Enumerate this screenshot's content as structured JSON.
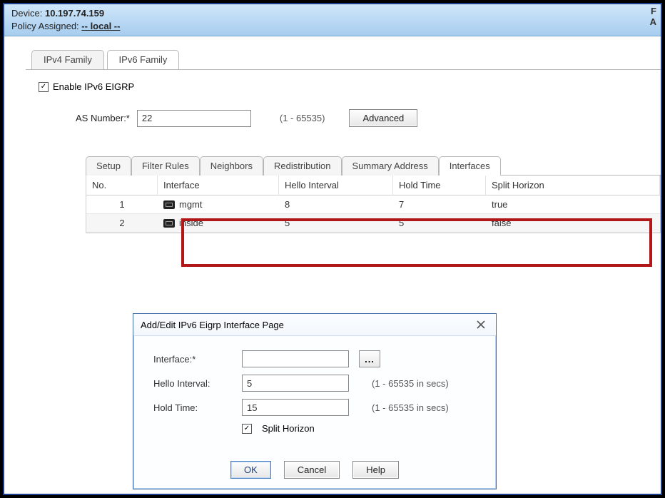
{
  "header": {
    "device_label": "Device:",
    "device_value": "10.197.74.159",
    "policy_label": "Policy Assigned:",
    "policy_value": "-- local --",
    "right1": "F",
    "right2": "A"
  },
  "family_tabs": {
    "ipv4": "IPv4 Family",
    "ipv6": "IPv6 Family"
  },
  "enable_label": "Enable IPv6 EIGRP",
  "as_label": "AS Number:*",
  "as_value": "22",
  "as_range": "(1 - 65535)",
  "advanced_btn": "Advanced",
  "sub_tabs": {
    "setup": "Setup",
    "filter": "Filter Rules",
    "neighbors": "Neighbors",
    "redistribution": "Redistribution",
    "summary": "Summary Address",
    "interfaces": "Interfaces"
  },
  "table": {
    "headers": {
      "no": "No.",
      "iface": "Interface",
      "hello": "Hello Interval",
      "hold": "Hold Time",
      "split": "Split Horizon"
    },
    "rows": [
      {
        "no": "1",
        "iface": "mgmt",
        "hello": "8",
        "hold": "7",
        "split": "true"
      },
      {
        "no": "2",
        "iface": "inside",
        "hello": "5",
        "hold": "5",
        "split": "false"
      }
    ]
  },
  "dialog": {
    "title": "Add/Edit IPv6 Eigrp Interface Page",
    "iface_lbl": "Interface:*",
    "iface_val": "",
    "browse": "...",
    "hello_lbl": "Hello Interval:",
    "hello_val": "5",
    "hold_lbl": "Hold Time:",
    "hold_val": "15",
    "range_hint": "(1 - 65535 in secs)",
    "split_lbl": "Split Horizon",
    "ok": "OK",
    "cancel": "Cancel",
    "help": "Help"
  }
}
